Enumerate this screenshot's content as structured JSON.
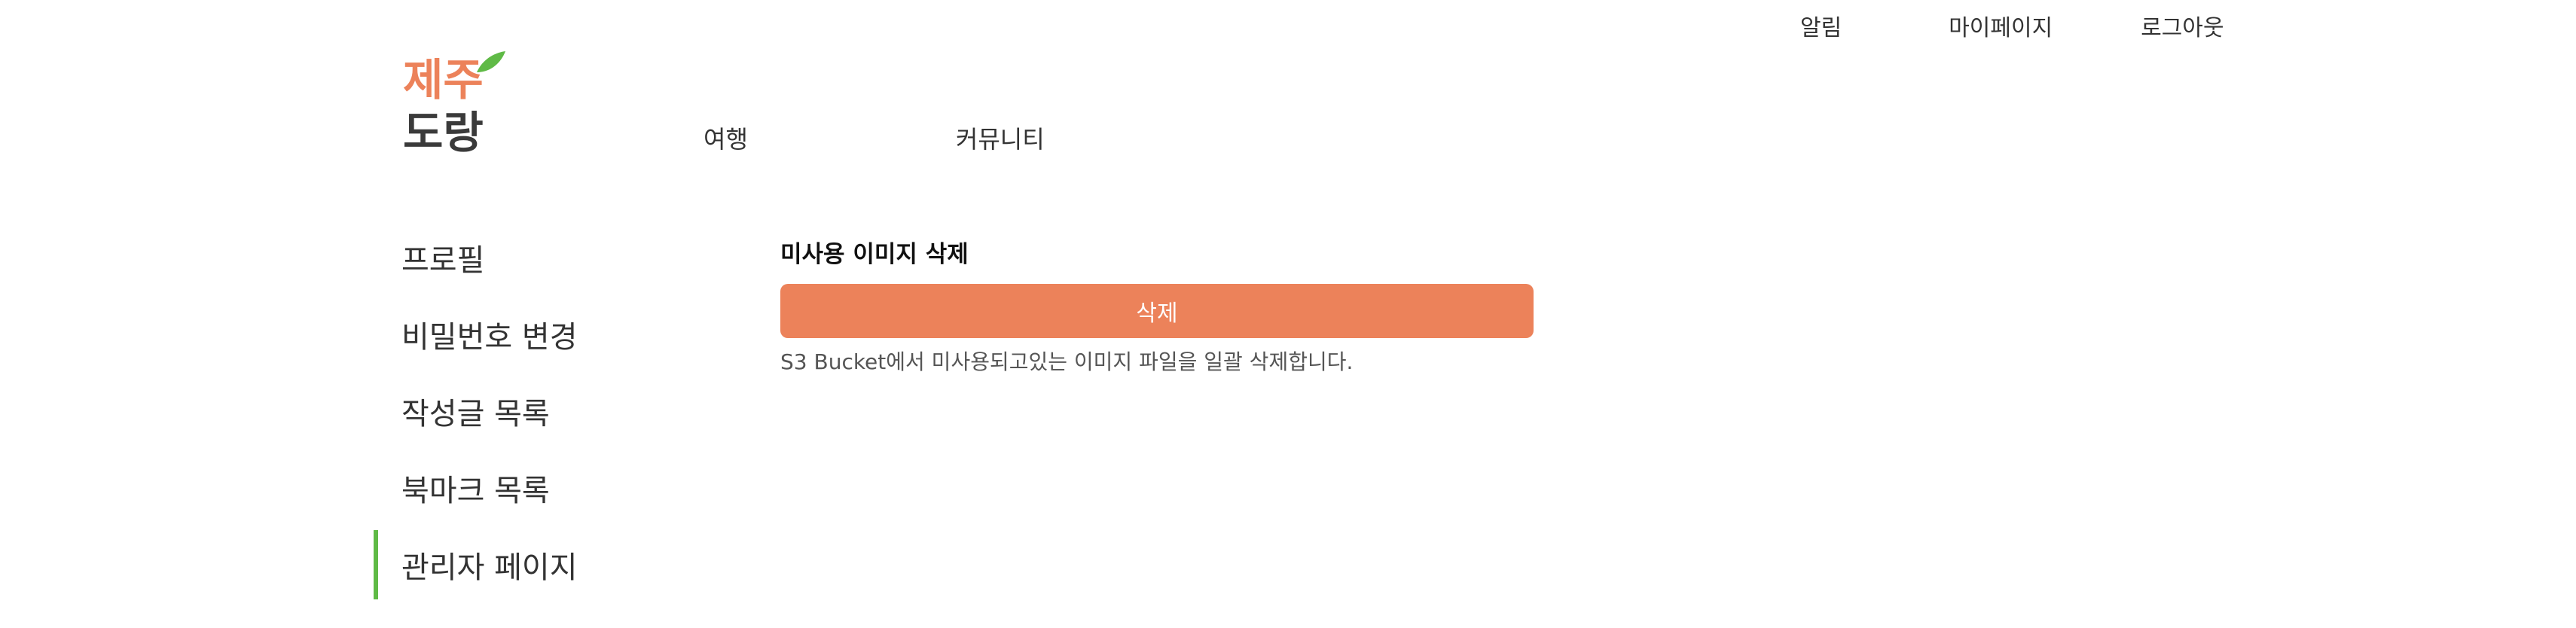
{
  "header": {
    "top_links": {
      "alerts": "알림",
      "mypage": "마이페이지",
      "logout": "로그아웃"
    },
    "logo": {
      "line1": "제주",
      "line2": "도랑"
    },
    "main_nav": {
      "travel": "여행",
      "community": "커뮤니티"
    }
  },
  "sidebar": {
    "items": [
      {
        "label": "프로필"
      },
      {
        "label": "비밀번호 변경"
      },
      {
        "label": "작성글 목록"
      },
      {
        "label": "북마크 목록"
      },
      {
        "label": "관리자 페이지",
        "active": true
      }
    ]
  },
  "main": {
    "section_title": "미사용 이미지 삭제",
    "delete_button_label": "삭제",
    "description": "S3 Bucket에서 미사용되고있는 이미지 파일을 일괄 삭제합니다."
  },
  "colors": {
    "accent": "#ec825a",
    "active_indicator": "#5fba46",
    "logo_top": "#ec825a",
    "logo_bottom": "#3a3a3a",
    "logo_leaf": "#5fba46"
  }
}
